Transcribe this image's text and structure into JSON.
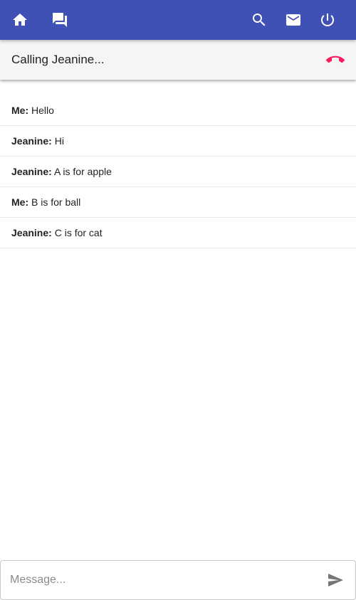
{
  "toolbar": {
    "background": "#3f51b5",
    "left_icons": [
      "home-icon",
      "forum-icon"
    ],
    "right_icons": [
      "search-icon",
      "mail-icon",
      "power-icon"
    ]
  },
  "call": {
    "status": "Calling Jeanine...",
    "hangup_icon": "call-end-icon",
    "hangup_color": "#ff1a5e"
  },
  "messages": [
    {
      "sender": "Me:",
      "text": "Hello"
    },
    {
      "sender": "Jeanine:",
      "text": "Hi"
    },
    {
      "sender": "Jeanine:",
      "text": "A is for apple"
    },
    {
      "sender": "Me:",
      "text": "B is for ball"
    },
    {
      "sender": "Jeanine:",
      "text": "C is for cat"
    }
  ],
  "composer": {
    "value": "",
    "placeholder": "Message...",
    "send_icon": "send-icon"
  }
}
